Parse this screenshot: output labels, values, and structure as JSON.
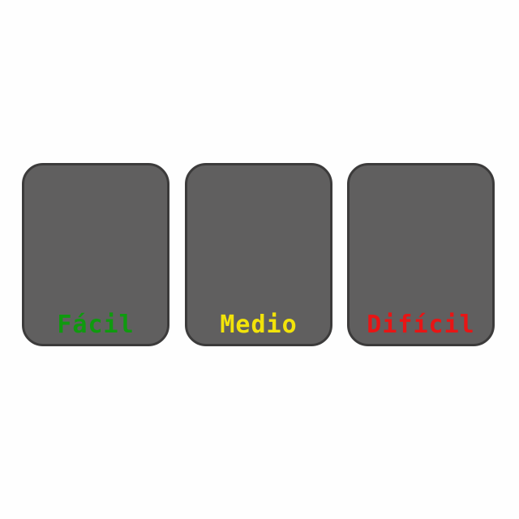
{
  "difficulty": {
    "options": [
      {
        "label": "Fácil",
        "color": "#0f9a0f"
      },
      {
        "label": "Medio",
        "color": "#f2e30a"
      },
      {
        "label": "Difícil",
        "color": "#e81515"
      }
    ]
  }
}
